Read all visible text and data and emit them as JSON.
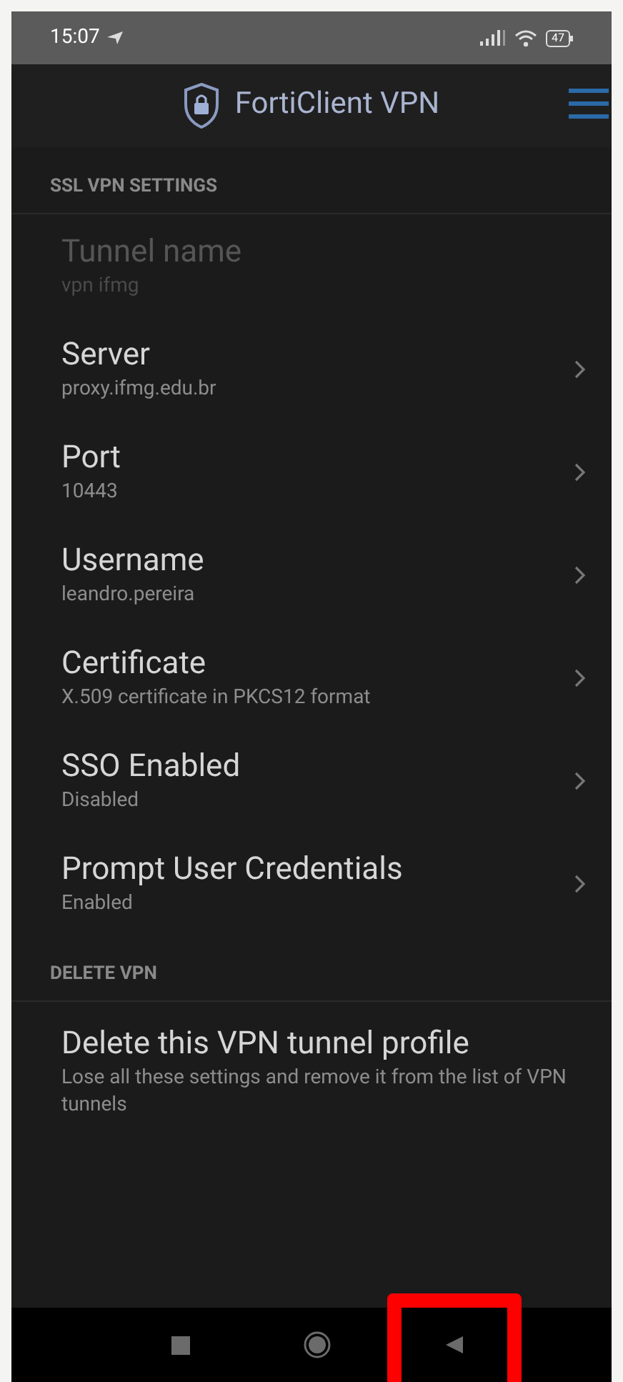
{
  "status_bar": {
    "time": "15:07",
    "battery": "47"
  },
  "header": {
    "title": "FortiClient VPN"
  },
  "sections": [
    {
      "title": "SSL VPN SETTINGS",
      "items": [
        {
          "title": "Tunnel name",
          "value": "vpn ifmg",
          "disabled": true
        },
        {
          "title": "Server",
          "value": "proxy.ifmg.edu.br",
          "disabled": false
        },
        {
          "title": "Port",
          "value": "10443",
          "disabled": false
        },
        {
          "title": "Username",
          "value": "leandro.pereira",
          "disabled": false
        },
        {
          "title": "Certificate",
          "value": "X.509 certificate in PKCS12 format",
          "disabled": false
        },
        {
          "title": "SSO Enabled",
          "value": "Disabled",
          "disabled": false
        },
        {
          "title": "Prompt User Credentials",
          "value": "Enabled",
          "disabled": false
        }
      ]
    },
    {
      "title": "DELETE VPN",
      "action": {
        "title": "Delete this VPN tunnel profile",
        "description": "Lose all these settings and remove it from the list of VPN tunnels"
      }
    }
  ],
  "nav_bar": [
    {
      "kind": "recents",
      "highlighted": false
    },
    {
      "kind": "home",
      "highlighted": false
    },
    {
      "kind": "back",
      "highlighted": true
    }
  ]
}
